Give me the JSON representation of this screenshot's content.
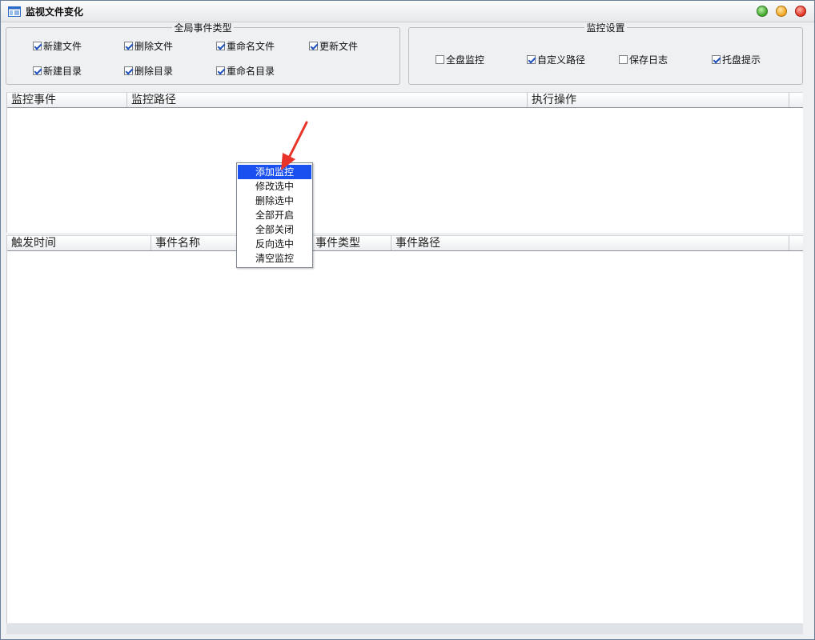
{
  "window": {
    "title": "监视文件变化",
    "icon": "app-window-icon",
    "controls": [
      "maximize-button",
      "minimize-button",
      "close-button"
    ]
  },
  "global_events": {
    "title": "全局事件类型",
    "options": [
      {
        "label": "新建文件",
        "checked": true
      },
      {
        "label": "删除文件",
        "checked": true
      },
      {
        "label": "重命名文件",
        "checked": true
      },
      {
        "label": "更新文件",
        "checked": true
      },
      {
        "label": "新建目录",
        "checked": true
      },
      {
        "label": "删除目录",
        "checked": true
      },
      {
        "label": "重命名目录",
        "checked": true
      }
    ]
  },
  "monitor_settings": {
    "title": "监控设置",
    "options": [
      {
        "label": "全盘监控",
        "checked": false
      },
      {
        "label": "自定义路径",
        "checked": true
      },
      {
        "label": "保存日志",
        "checked": false
      },
      {
        "label": "托盘提示",
        "checked": true
      }
    ]
  },
  "monitor_table": {
    "columns": [
      "监控事件",
      "监控路径",
      "执行操作"
    ],
    "rows": []
  },
  "event_table": {
    "columns": [
      "触发时间",
      "事件名称",
      "事件类型",
      "事件路径"
    ],
    "rows": []
  },
  "context_menu": {
    "items": [
      "添加监控",
      "修改选中",
      "删除选中",
      "全部开启",
      "全部关闭",
      "反向选中",
      "清空监控"
    ],
    "highlighted_index": 0
  },
  "colors": {
    "menu_highlight": "#1a4ff0",
    "annotation_arrow": "#e8332a",
    "checkmark": "#1d4fbf"
  }
}
